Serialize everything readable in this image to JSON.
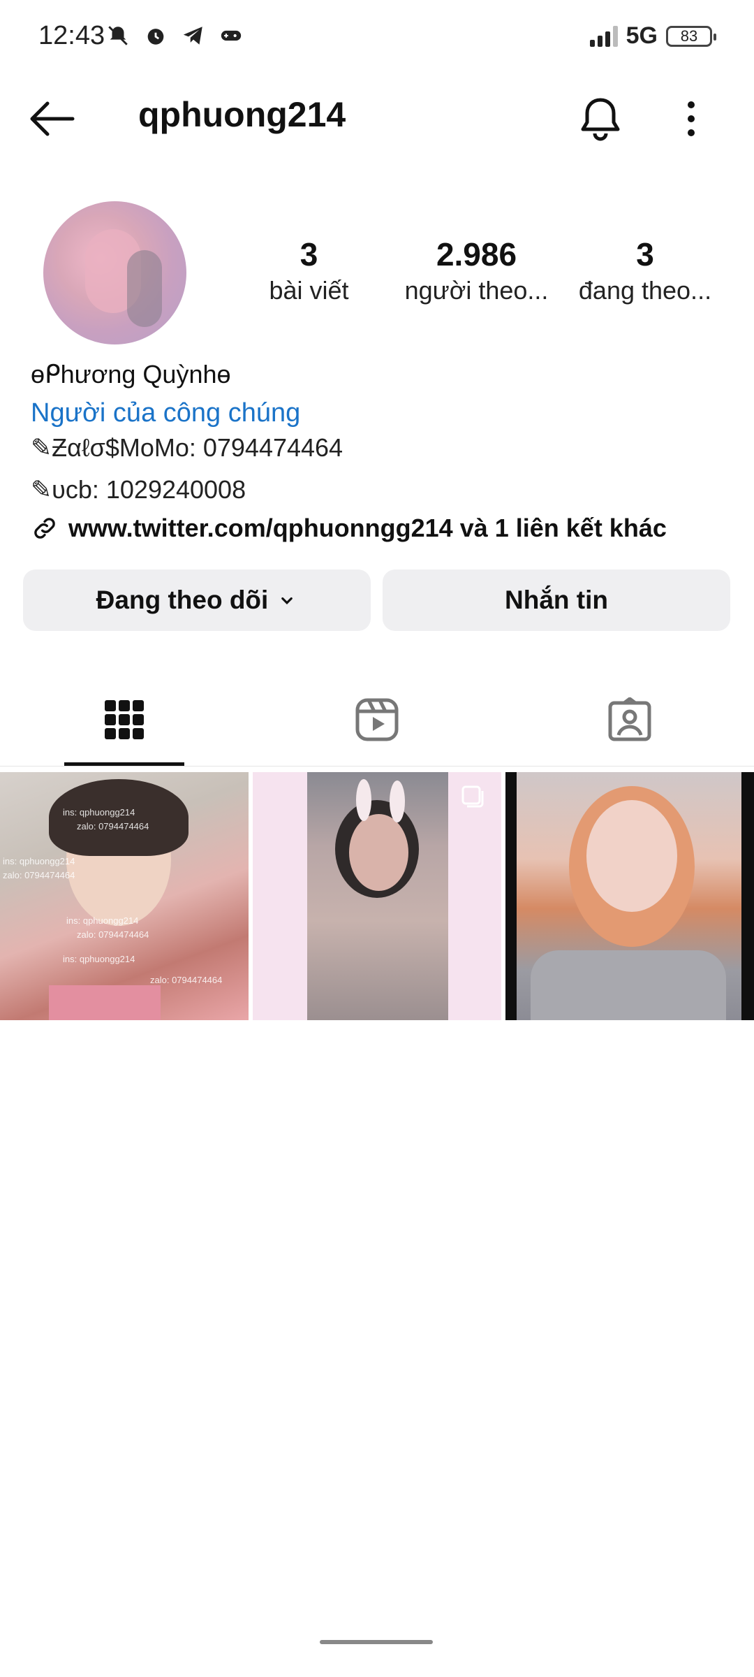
{
  "status_bar": {
    "time": "12:43",
    "network": "5G",
    "battery": "83"
  },
  "header": {
    "username": "qphuong214"
  },
  "profile": {
    "stats": [
      {
        "value": "3",
        "label": "bài viết"
      },
      {
        "value": "2.986",
        "label": "người theo..."
      },
      {
        "value": "3",
        "label": "đang theo..."
      }
    ],
    "display_name": "ɵᑭhương Quỳnhɵ",
    "category": "Người của công chúng",
    "bio_lines": [
      "✎Ƶαℓσ$MoMo: 0794474464",
      "✎υcb: 1029240008"
    ],
    "link_text": "www.twitter.com/qphuonngg214 và 1 liên kết khác"
  },
  "actions": {
    "following_label": "Đang theo dõi",
    "message_label": "Nhắn tin"
  },
  "tabs": [
    {
      "icon": "grid-icon",
      "active": true
    },
    {
      "icon": "reels-icon",
      "active": false
    },
    {
      "icon": "tagged-icon",
      "active": false
    }
  ],
  "posts": [
    {
      "watermark_lines": [
        "ins: qphuongg214",
        "zalo: 0794474464"
      ]
    },
    {
      "multi": true
    },
    {}
  ],
  "colors": {
    "accent_link": "#1a73c8",
    "button_bg": "#efeff1",
    "text": "#111111"
  }
}
